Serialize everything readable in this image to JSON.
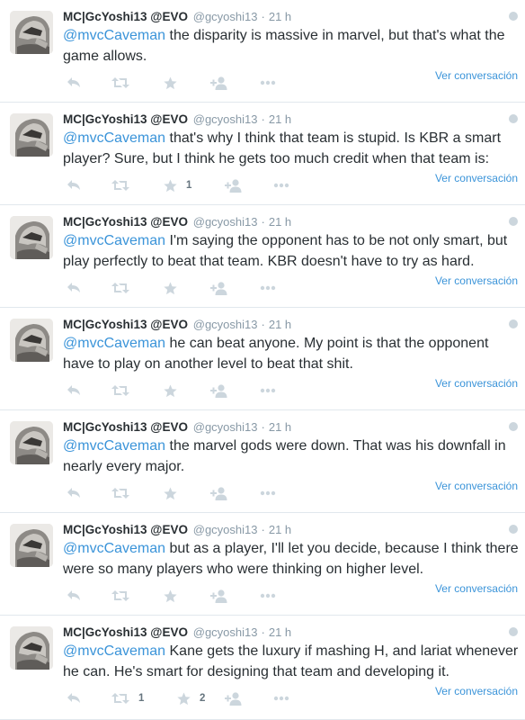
{
  "colors": {
    "link": "#3b94d9",
    "text": "#292f33",
    "muted": "#8899a6",
    "icon": "#ccd6dd"
  },
  "icons": [
    "reply-icon",
    "retweet-icon",
    "favorite-icon",
    "follow-icon",
    "more-dots-icon",
    "caret-icon"
  ],
  "tweets": [
    {
      "fullname": "MC|GcYoshi13 @EVO",
      "username": "@gcyoshi13",
      "dot": "·",
      "time": "21 h",
      "mention": "@mvcCaveman",
      "body": " the disparity is massive in marvel, but that's what the game allows.",
      "retweets": "",
      "favorites": "",
      "conversation": "Ver conversación"
    },
    {
      "fullname": "MC|GcYoshi13 @EVO",
      "username": "@gcyoshi13",
      "dot": "·",
      "time": "21 h",
      "mention": "@mvcCaveman",
      "body": " that's why I think that team is stupid. Is KBR a smart player? Sure, but I think he gets too much credit when that team is:",
      "retweets": "",
      "favorites": "1",
      "conversation": "Ver conversación"
    },
    {
      "fullname": "MC|GcYoshi13 @EVO",
      "username": "@gcyoshi13",
      "dot": "·",
      "time": "21 h",
      "mention": "@mvcCaveman",
      "body": " I'm saying the opponent has to be not only smart, but play perfectly to beat that team. KBR doesn't have to try as hard.",
      "retweets": "",
      "favorites": "",
      "conversation": "Ver conversación"
    },
    {
      "fullname": "MC|GcYoshi13 @EVO",
      "username": "@gcyoshi13",
      "dot": "·",
      "time": "21 h",
      "mention": "@mvcCaveman",
      "body": " he can beat anyone. My point is that the opponent have to play on another level to beat that shit.",
      "retweets": "",
      "favorites": "",
      "conversation": "Ver conversación"
    },
    {
      "fullname": "MC|GcYoshi13 @EVO",
      "username": "@gcyoshi13",
      "dot": "·",
      "time": "21 h",
      "mention": "@mvcCaveman",
      "body": " the marvel gods were down. That was his downfall in nearly every major.",
      "retweets": "",
      "favorites": "",
      "conversation": "Ver conversación"
    },
    {
      "fullname": "MC|GcYoshi13 @EVO",
      "username": "@gcyoshi13",
      "dot": "·",
      "time": "21 h",
      "mention": "@mvcCaveman",
      "body": " but as a player, I'll let you decide, because I think there were so many players who were thinking on higher level.",
      "retweets": "",
      "favorites": "",
      "conversation": "Ver conversación"
    },
    {
      "fullname": "MC|GcYoshi13 @EVO",
      "username": "@gcyoshi13",
      "dot": "·",
      "time": "21 h",
      "mention": "@mvcCaveman",
      "body": " Kane gets the luxury if mashing H, and lariat whenever he can. He's smart for designing that team and developing it.",
      "retweets": "1",
      "favorites": "2",
      "conversation": "Ver conversación"
    }
  ]
}
